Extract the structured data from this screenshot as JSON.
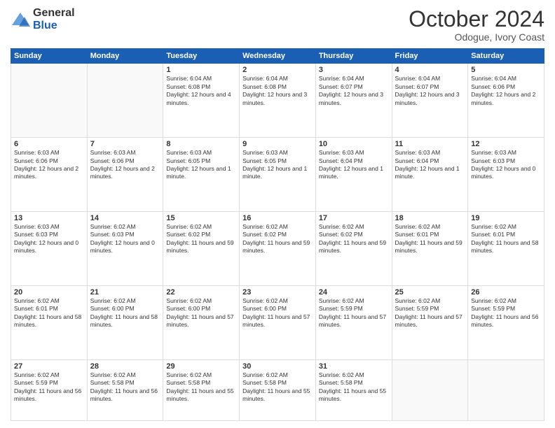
{
  "logo": {
    "line1": "General",
    "line2": "Blue"
  },
  "header": {
    "month": "October 2024",
    "location": "Odogue, Ivory Coast"
  },
  "weekdays": [
    "Sunday",
    "Monday",
    "Tuesday",
    "Wednesday",
    "Thursday",
    "Friday",
    "Saturday"
  ],
  "weeks": [
    [
      {
        "day": "",
        "empty": true
      },
      {
        "day": "",
        "empty": true
      },
      {
        "day": "1",
        "sr": "Sunrise: 6:04 AM",
        "ss": "Sunset: 6:08 PM",
        "dl": "Daylight: 12 hours and 4 minutes."
      },
      {
        "day": "2",
        "sr": "Sunrise: 6:04 AM",
        "ss": "Sunset: 6:08 PM",
        "dl": "Daylight: 12 hours and 3 minutes."
      },
      {
        "day": "3",
        "sr": "Sunrise: 6:04 AM",
        "ss": "Sunset: 6:07 PM",
        "dl": "Daylight: 12 hours and 3 minutes."
      },
      {
        "day": "4",
        "sr": "Sunrise: 6:04 AM",
        "ss": "Sunset: 6:07 PM",
        "dl": "Daylight: 12 hours and 3 minutes."
      },
      {
        "day": "5",
        "sr": "Sunrise: 6:04 AM",
        "ss": "Sunset: 6:06 PM",
        "dl": "Daylight: 12 hours and 2 minutes."
      }
    ],
    [
      {
        "day": "6",
        "sr": "Sunrise: 6:03 AM",
        "ss": "Sunset: 6:06 PM",
        "dl": "Daylight: 12 hours and 2 minutes."
      },
      {
        "day": "7",
        "sr": "Sunrise: 6:03 AM",
        "ss": "Sunset: 6:06 PM",
        "dl": "Daylight: 12 hours and 2 minutes."
      },
      {
        "day": "8",
        "sr": "Sunrise: 6:03 AM",
        "ss": "Sunset: 6:05 PM",
        "dl": "Daylight: 12 hours and 1 minute."
      },
      {
        "day": "9",
        "sr": "Sunrise: 6:03 AM",
        "ss": "Sunset: 6:05 PM",
        "dl": "Daylight: 12 hours and 1 minute."
      },
      {
        "day": "10",
        "sr": "Sunrise: 6:03 AM",
        "ss": "Sunset: 6:04 PM",
        "dl": "Daylight: 12 hours and 1 minute."
      },
      {
        "day": "11",
        "sr": "Sunrise: 6:03 AM",
        "ss": "Sunset: 6:04 PM",
        "dl": "Daylight: 12 hours and 1 minute."
      },
      {
        "day": "12",
        "sr": "Sunrise: 6:03 AM",
        "ss": "Sunset: 6:03 PM",
        "dl": "Daylight: 12 hours and 0 minutes."
      }
    ],
    [
      {
        "day": "13",
        "sr": "Sunrise: 6:03 AM",
        "ss": "Sunset: 6:03 PM",
        "dl": "Daylight: 12 hours and 0 minutes."
      },
      {
        "day": "14",
        "sr": "Sunrise: 6:02 AM",
        "ss": "Sunset: 6:03 PM",
        "dl": "Daylight: 12 hours and 0 minutes."
      },
      {
        "day": "15",
        "sr": "Sunrise: 6:02 AM",
        "ss": "Sunset: 6:02 PM",
        "dl": "Daylight: 11 hours and 59 minutes."
      },
      {
        "day": "16",
        "sr": "Sunrise: 6:02 AM",
        "ss": "Sunset: 6:02 PM",
        "dl": "Daylight: 11 hours and 59 minutes."
      },
      {
        "day": "17",
        "sr": "Sunrise: 6:02 AM",
        "ss": "Sunset: 6:02 PM",
        "dl": "Daylight: 11 hours and 59 minutes."
      },
      {
        "day": "18",
        "sr": "Sunrise: 6:02 AM",
        "ss": "Sunset: 6:01 PM",
        "dl": "Daylight: 11 hours and 59 minutes."
      },
      {
        "day": "19",
        "sr": "Sunrise: 6:02 AM",
        "ss": "Sunset: 6:01 PM",
        "dl": "Daylight: 11 hours and 58 minutes."
      }
    ],
    [
      {
        "day": "20",
        "sr": "Sunrise: 6:02 AM",
        "ss": "Sunset: 6:01 PM",
        "dl": "Daylight: 11 hours and 58 minutes."
      },
      {
        "day": "21",
        "sr": "Sunrise: 6:02 AM",
        "ss": "Sunset: 6:00 PM",
        "dl": "Daylight: 11 hours and 58 minutes."
      },
      {
        "day": "22",
        "sr": "Sunrise: 6:02 AM",
        "ss": "Sunset: 6:00 PM",
        "dl": "Daylight: 11 hours and 57 minutes."
      },
      {
        "day": "23",
        "sr": "Sunrise: 6:02 AM",
        "ss": "Sunset: 6:00 PM",
        "dl": "Daylight: 11 hours and 57 minutes."
      },
      {
        "day": "24",
        "sr": "Sunrise: 6:02 AM",
        "ss": "Sunset: 5:59 PM",
        "dl": "Daylight: 11 hours and 57 minutes."
      },
      {
        "day": "25",
        "sr": "Sunrise: 6:02 AM",
        "ss": "Sunset: 5:59 PM",
        "dl": "Daylight: 11 hours and 57 minutes."
      },
      {
        "day": "26",
        "sr": "Sunrise: 6:02 AM",
        "ss": "Sunset: 5:59 PM",
        "dl": "Daylight: 11 hours and 56 minutes."
      }
    ],
    [
      {
        "day": "27",
        "sr": "Sunrise: 6:02 AM",
        "ss": "Sunset: 5:59 PM",
        "dl": "Daylight: 11 hours and 56 minutes."
      },
      {
        "day": "28",
        "sr": "Sunrise: 6:02 AM",
        "ss": "Sunset: 5:58 PM",
        "dl": "Daylight: 11 hours and 56 minutes."
      },
      {
        "day": "29",
        "sr": "Sunrise: 6:02 AM",
        "ss": "Sunset: 5:58 PM",
        "dl": "Daylight: 11 hours and 55 minutes."
      },
      {
        "day": "30",
        "sr": "Sunrise: 6:02 AM",
        "ss": "Sunset: 5:58 PM",
        "dl": "Daylight: 11 hours and 55 minutes."
      },
      {
        "day": "31",
        "sr": "Sunrise: 6:02 AM",
        "ss": "Sunset: 5:58 PM",
        "dl": "Daylight: 11 hours and 55 minutes."
      },
      {
        "day": "",
        "empty": true
      },
      {
        "day": "",
        "empty": true
      }
    ]
  ]
}
